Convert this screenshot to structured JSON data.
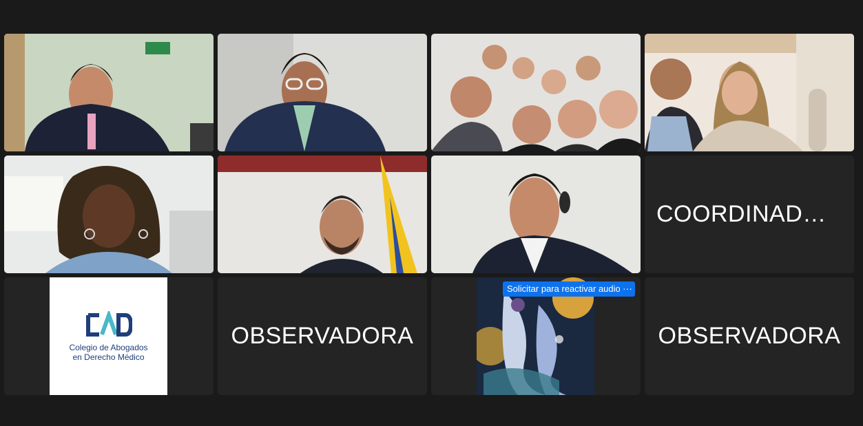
{
  "participants": [
    {
      "id": "p1",
      "type": "video"
    },
    {
      "id": "p2",
      "type": "video"
    },
    {
      "id": "p3",
      "type": "video"
    },
    {
      "id": "p4",
      "type": "video"
    },
    {
      "id": "p5",
      "type": "video"
    },
    {
      "id": "p6",
      "type": "video"
    },
    {
      "id": "p7",
      "type": "video"
    },
    {
      "id": "p8",
      "type": "name",
      "name": "COORDINADOR..."
    },
    {
      "id": "p9",
      "type": "logo",
      "logo_lines": [
        "Colegio de Abogados",
        "en Derecho Médico"
      ]
    },
    {
      "id": "p10",
      "type": "name",
      "name": "OBSERVADORA"
    },
    {
      "id": "p11",
      "type": "art",
      "unmute_label": "Solicitar para reactivar audio",
      "more_label": "···"
    },
    {
      "id": "p12",
      "type": "name",
      "name": "OBSERVADORA"
    }
  ],
  "colors": {
    "background": "#1a1a1a",
    "tile": "#242424",
    "active_speaker": "#23d959",
    "accent": "#0e72ed",
    "logo_navy": "#1f3f7a",
    "logo_teal": "#4ab8c8"
  },
  "icons": {
    "more": "ellipsis-icon",
    "logo": "cad-logo-icon"
  }
}
